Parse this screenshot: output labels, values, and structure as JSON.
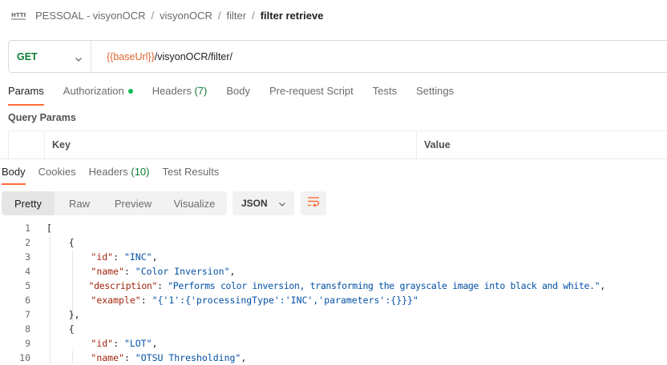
{
  "breadcrumb": {
    "icon": "http-icon",
    "items": [
      "PESSOAL - visyonOCR",
      "visyonOCR",
      "filter"
    ],
    "current": "filter retrieve",
    "separator": "/"
  },
  "request": {
    "method": "GET",
    "url_variable": "{{baseUrl}}",
    "url_path": "/visyonOCR/filter/"
  },
  "request_tabs": {
    "params": "Params",
    "authorization": "Authorization",
    "headers": "Headers",
    "headers_count": "(7)",
    "body": "Body",
    "prerequest": "Pre-request Script",
    "tests": "Tests",
    "settings": "Settings"
  },
  "query_params": {
    "title": "Query Params",
    "col_key": "Key",
    "col_value": "Value"
  },
  "response_tabs": {
    "body": "Body",
    "cookies": "Cookies",
    "headers": "Headers",
    "headers_count": "(10)",
    "test_results": "Test Results"
  },
  "view_modes": {
    "pretty": "Pretty",
    "raw": "Raw",
    "preview": "Preview",
    "visualize": "Visualize"
  },
  "format": "JSON",
  "colors": {
    "accent": "#ff6c37",
    "method_get": "#0a7d34",
    "variable": "#e0662f",
    "json_key": "#a1260d",
    "json_string": "#0451a5"
  },
  "code": {
    "lines": [
      {
        "n": "1",
        "p1": "[",
        "k": "",
        "p2": "",
        "s": "",
        "p3": ""
      },
      {
        "n": "2",
        "p1": "    {",
        "k": "",
        "p2": "",
        "s": "",
        "p3": ""
      },
      {
        "n": "3",
        "p1": "        ",
        "k": "\"id\"",
        "p2": ": ",
        "s": "\"INC\"",
        "p3": ","
      },
      {
        "n": "4",
        "p1": "        ",
        "k": "\"name\"",
        "p2": ": ",
        "s": "\"Color Inversion\"",
        "p3": ","
      },
      {
        "n": "5",
        "p1": "        ",
        "k": "\"description\"",
        "p2": ": ",
        "s": "\"Performs color inversion, transforming the grayscale image into black and white.\"",
        "p3": ","
      },
      {
        "n": "6",
        "p1": "        ",
        "k": "\"example\"",
        "p2": ": ",
        "s": "\"{'1':{'processingType':'INC','parameters':{}}}\"",
        "p3": ""
      },
      {
        "n": "7",
        "p1": "    },",
        "k": "",
        "p2": "",
        "s": "",
        "p3": ""
      },
      {
        "n": "8",
        "p1": "    {",
        "k": "",
        "p2": "",
        "s": "",
        "p3": ""
      },
      {
        "n": "9",
        "p1": "        ",
        "k": "\"id\"",
        "p2": ": ",
        "s": "\"LOT\"",
        "p3": ","
      },
      {
        "n": "10",
        "p1": "        ",
        "k": "\"name\"",
        "p2": ": ",
        "s": "\"OTSU Thresholding\"",
        "p3": ","
      }
    ]
  }
}
